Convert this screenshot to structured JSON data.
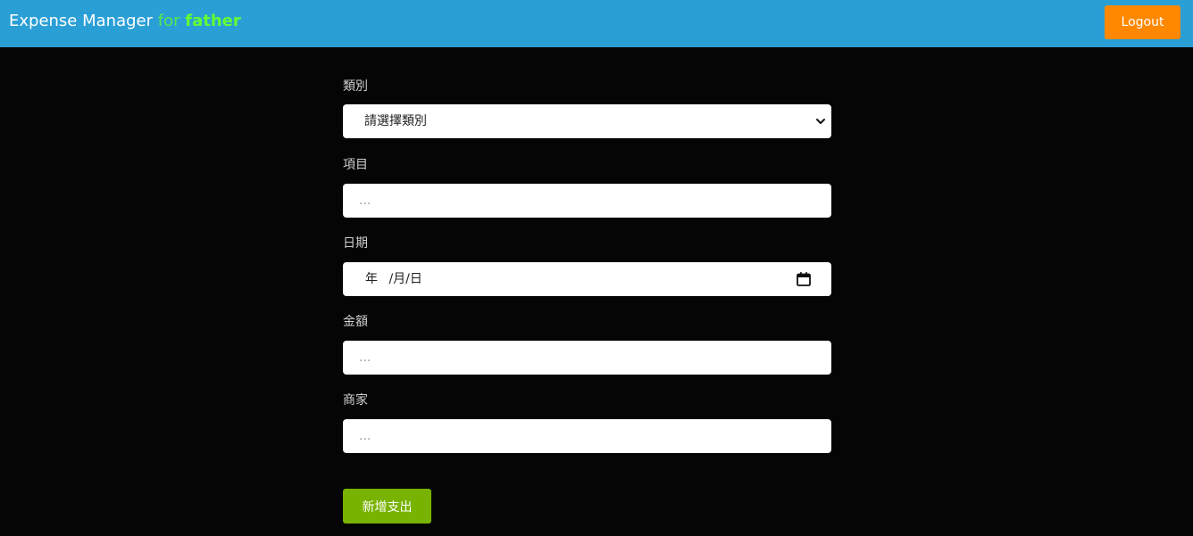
{
  "header": {
    "app_name": "Expense Manager",
    "for_text": "for",
    "user_name": "father",
    "logout_label": "Logout"
  },
  "form": {
    "category": {
      "label": "類別",
      "selected": "請選擇類別"
    },
    "item": {
      "label": "項目",
      "placeholder": "..."
    },
    "date": {
      "label": "日期",
      "year": "年",
      "month": "月",
      "day": "日",
      "separator": "/"
    },
    "amount": {
      "label": "金額",
      "placeholder": "..."
    },
    "merchant": {
      "label": "商家",
      "placeholder": "..."
    },
    "submit_label": "新增支出"
  },
  "colors": {
    "header_bg": "#2a9fd6",
    "page_bg": "#050505",
    "logout_bg": "#ff8800",
    "submit_bg": "#77b300",
    "user_name": "#66ff33"
  }
}
